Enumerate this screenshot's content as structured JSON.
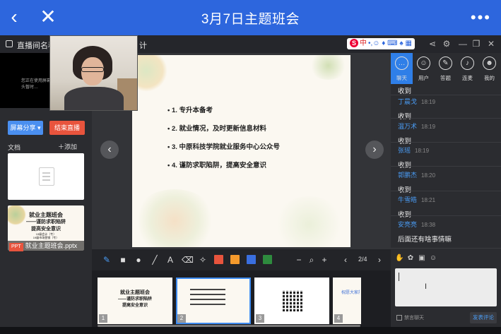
{
  "header": {
    "title": "3月7日主题班会",
    "back_icon": "chevron-left-icon",
    "close_icon": "close-icon",
    "more_icon": "more-horizontal-icon"
  },
  "subbar": {
    "live_label": "直播间名称：",
    "live_tail": "计",
    "ime_text": "中"
  },
  "preview": {
    "message": "您正在使用屏幕共享 摄像头暂时…"
  },
  "left_panel": {
    "share_button": "屏幕分享 ▾",
    "end_button": "结束直播",
    "docs_label": "文档",
    "add_label": "＋添加",
    "doc_card_title_line1": "就业主题班会",
    "doc_card_title_line2": "——谨防求职陷阱",
    "doc_card_title_line3": "提高安全意识",
    "doc_card_sub1": "19级会计（专）",
    "doc_card_sub2": "19级市场营销（专）",
    "doc_badge": "PPT",
    "doc_name": "就业主题班会.pptx"
  },
  "slide": {
    "items": [
      "• 1. 专升本备考",
      "• 2. 就业情况，及时更新信息材料",
      "• 3. 中原科技学院就业服务中心公众号",
      "• 4. 谨防求职陷阱，提高安全意识"
    ]
  },
  "toolbar": {
    "text_tool": "A",
    "minus": "−",
    "plus": "+",
    "page_indicator": "2/4",
    "colors": [
      "#e8543d",
      "#f59a2c",
      "#3a6fe0",
      "#2e8b3e"
    ]
  },
  "thumbnails": {
    "items": [
      {
        "num": "1",
        "line1": "就业主题班会",
        "line2": "——谨防求职陷阱",
        "line3": "提高安全意识"
      },
      {
        "num": "2"
      },
      {
        "num": "3"
      },
      {
        "num": "4",
        "line1": "祝愿大家前程似锦，毕"
      }
    ]
  },
  "right_panel": {
    "tabs": [
      {
        "label": "聊天",
        "icon": "chat-icon"
      },
      {
        "label": "用户",
        "icon": "users-icon"
      },
      {
        "label": "答题",
        "icon": "pencil-icon"
      },
      {
        "label": "连麦",
        "icon": "microphone-icon"
      },
      {
        "label": "我的",
        "icon": "profile-icon"
      }
    ],
    "messages": [
      {
        "name": "",
        "time": "",
        "text": "收到"
      },
      {
        "name": "丁晨戈",
        "time": "18:19",
        "text": "收到"
      },
      {
        "name": "温万术",
        "time": "18:19",
        "text": "收到"
      },
      {
        "name": "张瑶",
        "time": "18:19",
        "text": "收到"
      },
      {
        "name": "郭鹏杰",
        "time": "18:20",
        "text": "收到"
      },
      {
        "name": "牛雪皓",
        "time": "18:21",
        "text": "收到"
      },
      {
        "name": "安亮亮",
        "time": "18:38",
        "text": "后面还有啥事情嘛"
      }
    ],
    "checkbox_label": "禁言聊天",
    "send_button": "发表评论"
  }
}
